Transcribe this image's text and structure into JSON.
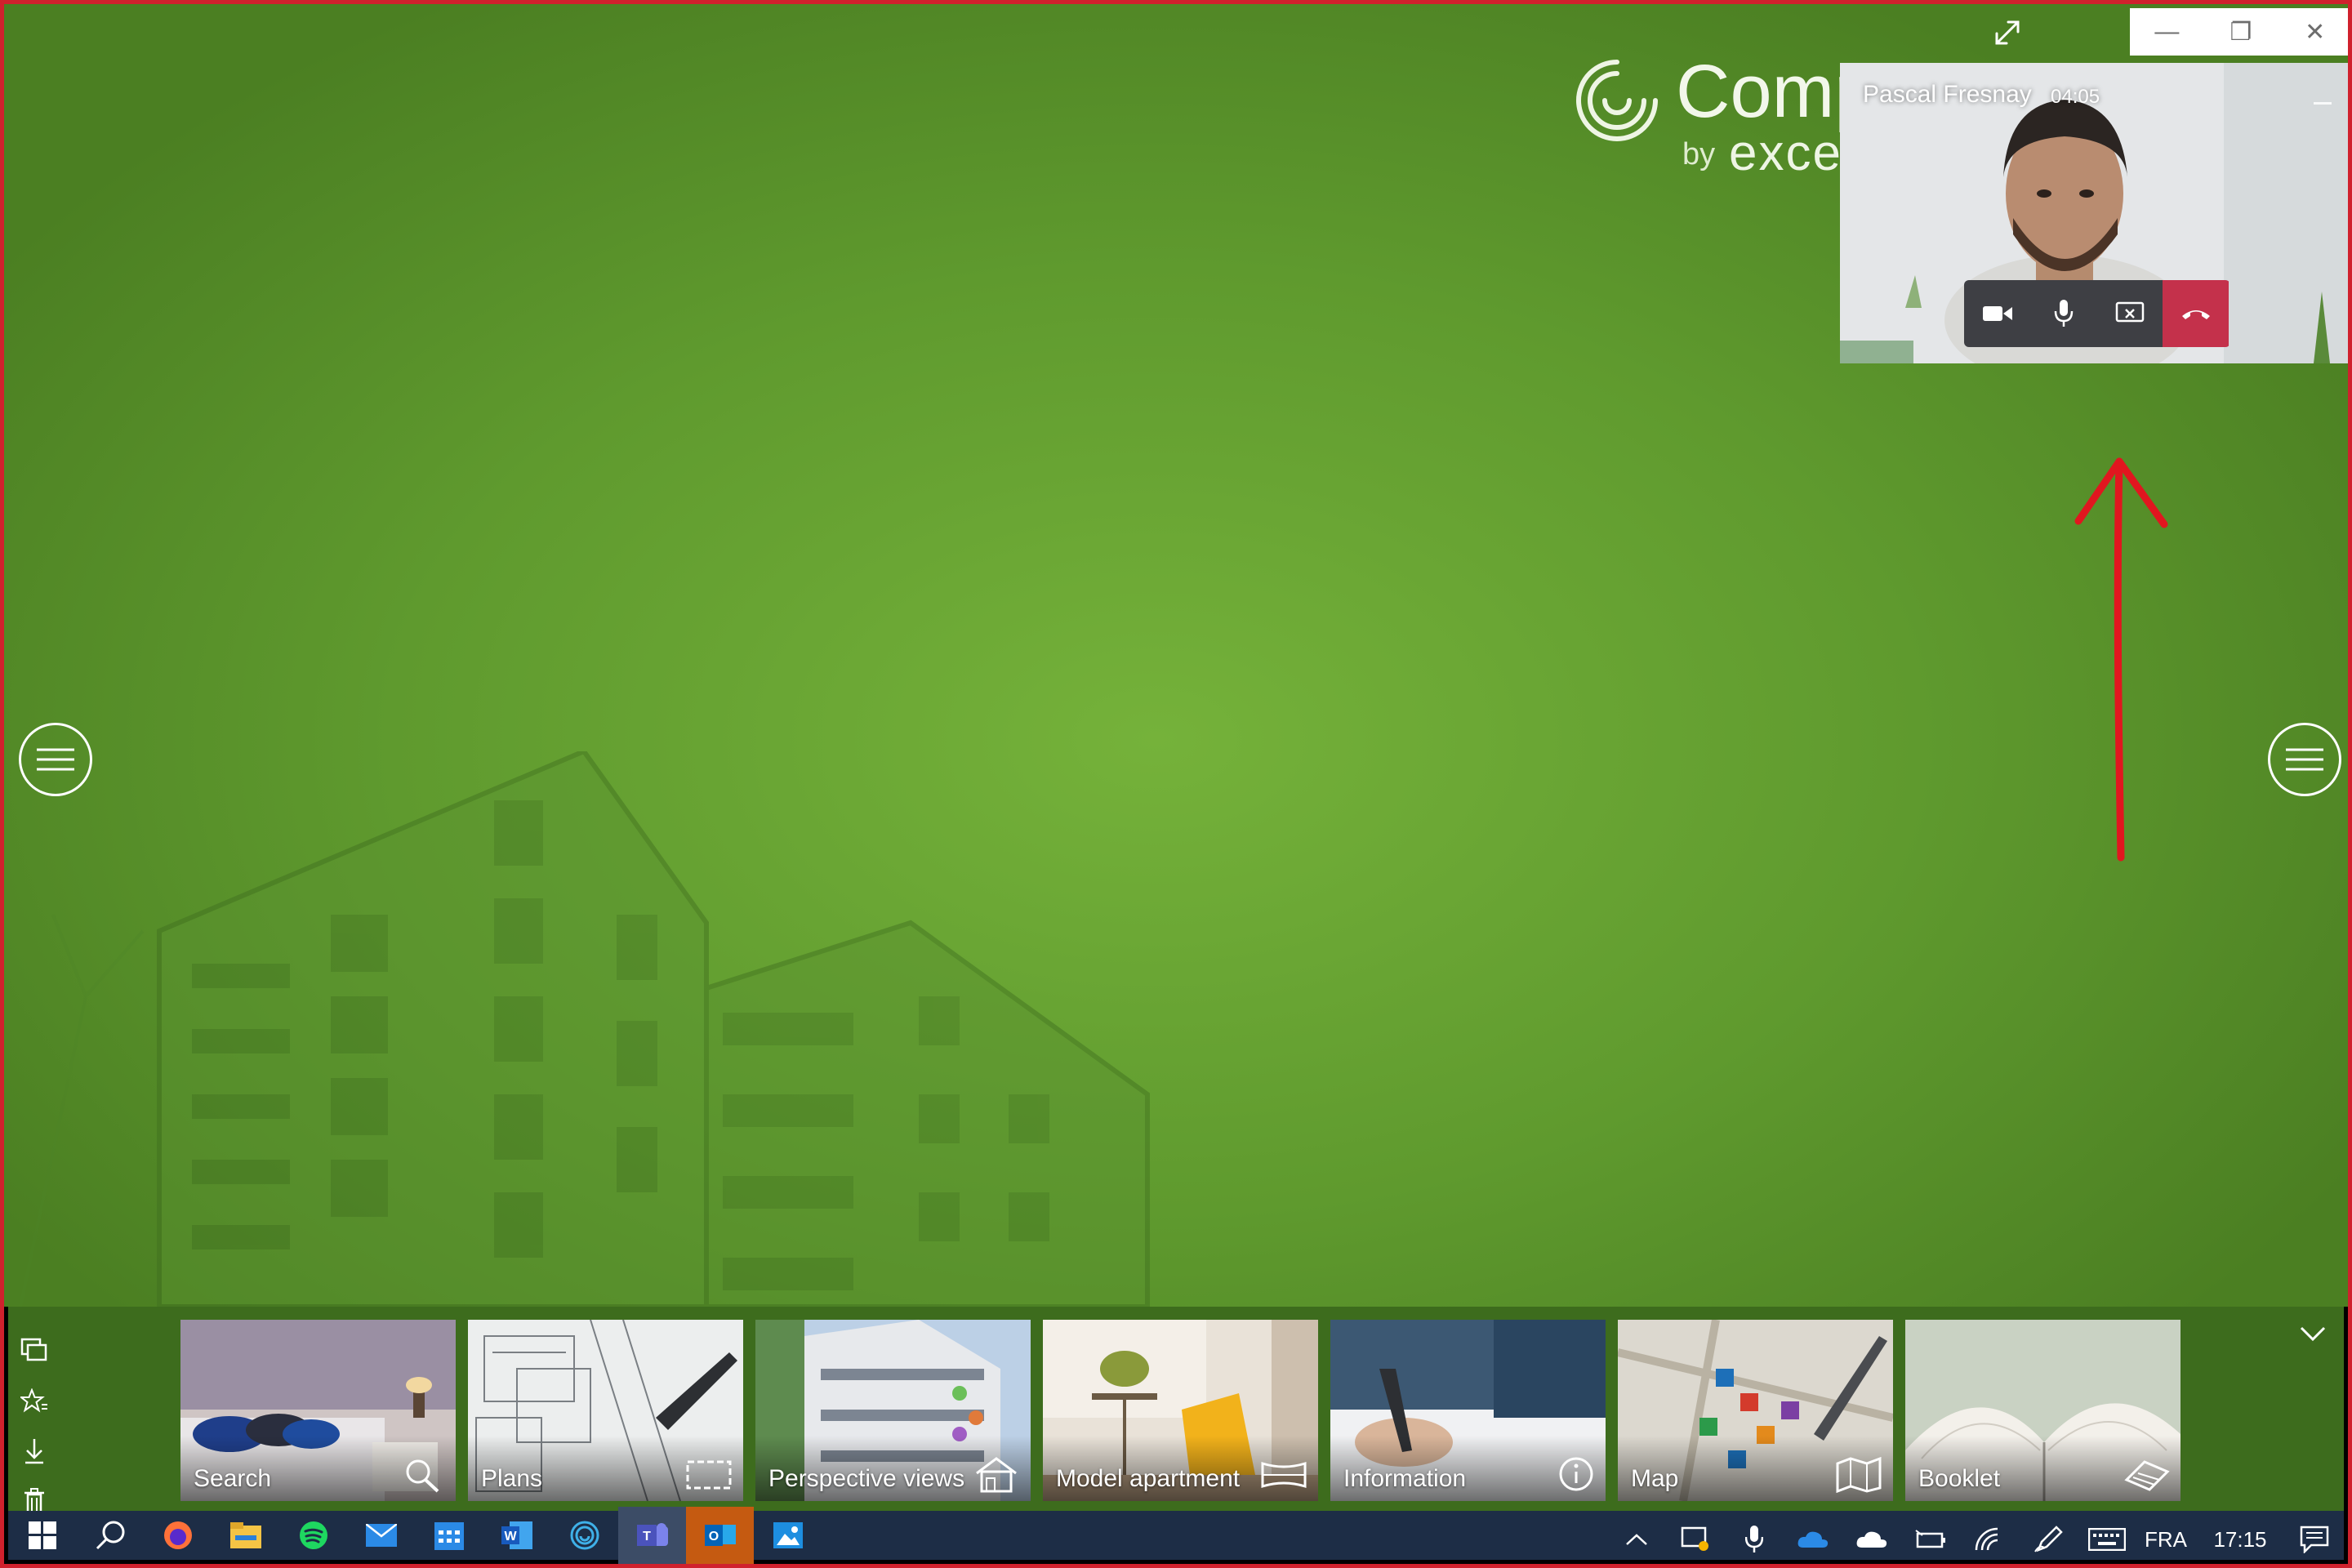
{
  "logo": {
    "name": "Comp",
    "by": "by",
    "brand": "exce"
  },
  "window_controls": {
    "minimize": "—",
    "restore": "❐",
    "close": "✕"
  },
  "call": {
    "caller": "Pascal Fresnay",
    "timer": "04:05"
  },
  "tiles": [
    {
      "label": "Search",
      "icon": "search-icon"
    },
    {
      "label": "Plans",
      "icon": "floorplan-icon"
    },
    {
      "label": "Perspective views",
      "icon": "house-icon"
    },
    {
      "label": "Model apartment",
      "icon": "panorama-icon"
    },
    {
      "label": "Information",
      "icon": "info-icon"
    },
    {
      "label": "Map",
      "icon": "map-icon"
    },
    {
      "label": "Booklet",
      "icon": "booklet-icon"
    }
  ],
  "taskbar": {
    "apps": [
      "start",
      "search",
      "firefox",
      "file-explorer",
      "spotify",
      "mail",
      "calendar",
      "word",
      "companion",
      "teams",
      "outlook",
      "photos"
    ],
    "language": "FRA",
    "clock": "17:15"
  },
  "colors": {
    "frame": "#d0212d",
    "app_green": "#6aa834",
    "tile_bar": "#3d6c1d",
    "taskbar": "#1d2d46",
    "hangup": "#c4314b",
    "arrow": "#e1161f"
  }
}
